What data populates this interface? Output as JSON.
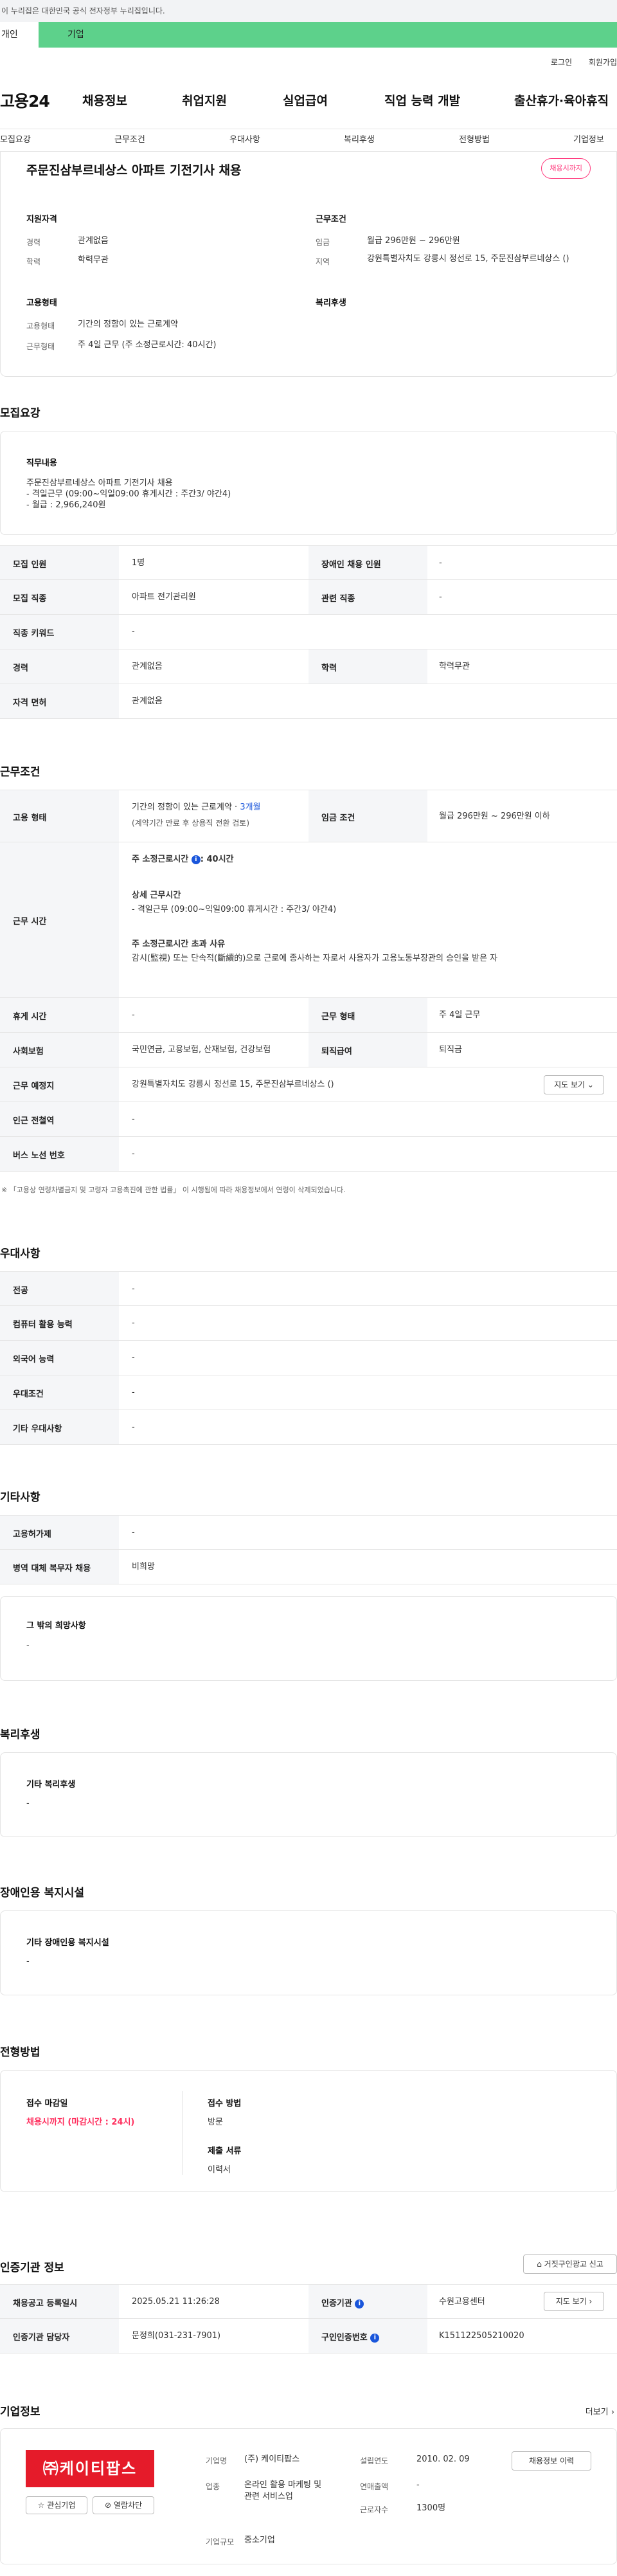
{
  "gov_banner": "이 누리집은 대한민국 공식 전자정부 누리집입니다.",
  "user_tabs": [
    "개인",
    "기업"
  ],
  "top_links": [
    "로그인",
    "회원가입"
  ],
  "site_logo": "고용24",
  "gnb": [
    "채용정보",
    "취업지원",
    "실업급여",
    "직업 능력 개발",
    "출산휴가·육아휴직"
  ],
  "subnav": [
    "모집요강",
    "근무조건",
    "우대사항",
    "복리후생",
    "전형방법",
    "기업정보"
  ],
  "job": {
    "title": "주문진삼부르네상스 아파트 기전기사 채용",
    "badge": "채용시까지",
    "qual_head": "지원자격",
    "career_lbl": "경력",
    "career": "관계없음",
    "edu_lbl": "학력",
    "edu": "학력무관",
    "emp_head": "고용형태",
    "emptype_lbl": "고용형태",
    "emptype": "기간의 정함이 있는 근로계약",
    "worktype_lbl": "근무형태",
    "worktype": "주 4일 근무 (주 소정근로시간: 40시간)",
    "cond_head": "근무조건",
    "wage_lbl": "임금",
    "wage": "월급 296만원 ~ 296만원",
    "region_lbl": "지역",
    "region": "강원특별자치도 강릉시 정선로 15, 주문진삼부르네상스 ()",
    "welfare_head": "복리후생"
  },
  "recruit": {
    "heading": "모집요강",
    "duty_title": "직무내용",
    "duty_lines": [
      "주문진삼부르네상스 아파트 기전기사 채용",
      "- 격일근무 (09:00~익일09:00  휴게시간 : 주간3/ 야간4)",
      "- 월급 : 2,966,240원"
    ],
    "rows": [
      {
        "l1": "모집 인원",
        "v1": "1명",
        "l2": "장애인 채용 인원",
        "v2": "-"
      },
      {
        "l1": "모집 직종",
        "v1": "아파트 전기관리원",
        "l2": "관련 직종",
        "v2": "-"
      },
      {
        "l1": "직종 키워드",
        "v1": "-"
      },
      {
        "l1": "경력",
        "v1": "관계없음",
        "l2": "학력",
        "v2": "학력무관"
      },
      {
        "l1": "자격 면허",
        "v1": "관계없음"
      }
    ]
  },
  "conditions": {
    "heading": "근무조건",
    "emp_lbl": "고용 형태",
    "emp_val": "기간의 정함이 있는 근로계약 · ",
    "emp_months": "3개월",
    "emp_note": "(계약기간 만료 후 상용직 전환 검토)",
    "wage_lbl": "임금 조건",
    "wage_val": "월급 296만원 ~ 296만원 이하",
    "hours_lbl": "근무 시간",
    "hours_weekly_lbl": "주 소정근로시간",
    "hours_weekly": ": 40시간",
    "hours_detail_title": "상세 근무시간",
    "hours_detail": "- 격일근무 (09:00~익일09:00  휴게시간 : 주간3/ 야간4)",
    "hours_over_title": "주 소정근로시간 초과 사유",
    "hours_over": "감시(監視) 또는 단속적(斷續的)으로 근로에 종사하는 자로서 사용자가 고용노동부장관의 승인을 받은 자",
    "rows": [
      {
        "l1": "휴게 시간",
        "v1": "-",
        "l2": "근무 형태",
        "v2": "주 4일 근무"
      },
      {
        "l1": "사회보험",
        "v1": "국민연금, 고용보험, 산재보험, 건강보험",
        "l2": "퇴직급여",
        "v2": "퇴직금"
      }
    ],
    "place_lbl": "근무 예정지",
    "place_val": "강원특별자치도 강릉시 정선로 15, 주문진삼부르네상스 ()",
    "map_btn": "지도 보기",
    "station_lbl": "인근 전철역",
    "station_val": "-",
    "bus_lbl": "버스 노선 번호",
    "bus_val": "-",
    "footnote": "※ 「고용상 연령차별금지 및 고령자 고용촉진에 관한 법률」 이 시행됨에 따라 채용정보에서 연령이 삭제되었습니다."
  },
  "preference": {
    "heading": "우대사항",
    "rows": [
      {
        "l": "전공",
        "v": "-"
      },
      {
        "l": "컴퓨터 활용 능력",
        "v": "-"
      },
      {
        "l": "외국어 능력",
        "v": "-"
      },
      {
        "l": "우대조건",
        "v": "-"
      },
      {
        "l": "기타 우대사항",
        "v": "-"
      }
    ]
  },
  "others": {
    "heading": "기타사항",
    "rows": [
      {
        "l": "고용허가제",
        "v": "-"
      },
      {
        "l": "병역 대체 복무자 채용",
        "v": "비희망"
      }
    ],
    "wish_title": "그 밖의 희망사항",
    "wish_val": "-"
  },
  "welfare": {
    "heading": "복리후생",
    "title": "기타 복리후생",
    "val": "-"
  },
  "disability": {
    "heading": "장애인용 복지시설",
    "title": "기타 장애인용 복지시설",
    "val": "-"
  },
  "selection": {
    "heading": "전형방법",
    "deadline_title": "접수 마감일",
    "deadline_val": "채용시까지 (마감시간 : 24시)",
    "method_title": "접수 방법",
    "method_val": "방문",
    "docs_title": "제출 서류",
    "docs_val": "이력서"
  },
  "certification": {
    "heading": "인증기관 정보",
    "report_btn": "거짓구인광고 신고",
    "posted_lbl": "채용공고 등록일시",
    "posted_val": "2025.05.21 11:26:28",
    "agency_lbl": "인증기관",
    "agency_val": "수원고용센터",
    "manager_lbl": "인증기관 담당자",
    "manager_val": "문정희(031-231-7901)",
    "map_btn": "지도 보기",
    "number_lbl": "구인인증번호",
    "number_val": "K151122505210020"
  },
  "company": {
    "heading": "기업정보",
    "more": "더보기",
    "logo_text": "㈜케이티팝스",
    "fav_btn": "관심기업",
    "block_btn": "열람차단",
    "name_lbl": "기업명",
    "name_val": "(주) 케이티팝스",
    "industry_lbl": "업종",
    "industry_val": "온라인 활용 마케팅 및 관련 서비스업",
    "size_lbl": "기업규모",
    "size_val": "중소기업",
    "founded_lbl": "설립연도",
    "founded_val": "2010. 02. 09",
    "sales_lbl": "연매출액",
    "sales_val": "-",
    "employees_lbl": "근로자수",
    "employees_val": "1300명",
    "jobs_btn": "채용정보 이력"
  }
}
